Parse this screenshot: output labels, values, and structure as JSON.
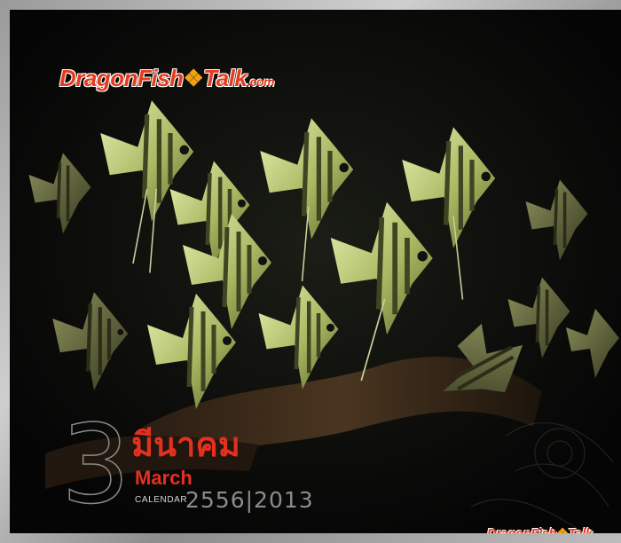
{
  "logo": {
    "part1": "Dragon",
    "part2": "Fish",
    "part3": "Talk",
    "part4": ".com",
    "fish_icon": "goldfish-icon"
  },
  "month": {
    "number": "3",
    "thai_name": "มีนาคม",
    "english_name": "March"
  },
  "calendar_label": "CALENDAR",
  "years": "2556|2013",
  "colors": {
    "logo_red": "#e63a1c",
    "month_red": "#e4301f",
    "photo_background": "#060606"
  }
}
